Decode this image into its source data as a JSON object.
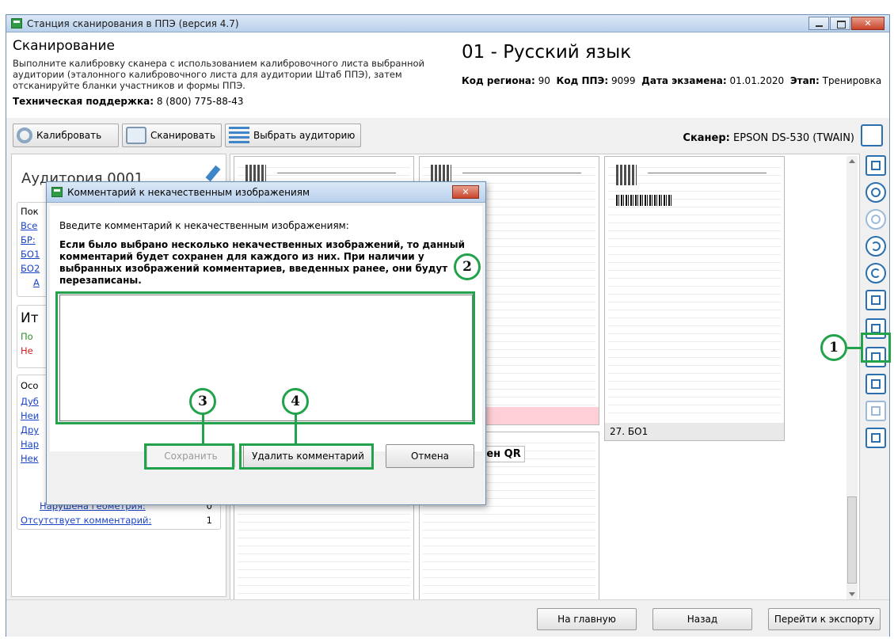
{
  "window": {
    "title": "Станция сканирования в ППЭ (версия 4.7)",
    "close_glyph": "✕"
  },
  "header": {
    "title": "Сканирование",
    "description": "Выполните калибровку сканера с использованием калибровочного листа выбранной аудитории (эталонного калибровочного листа для аудитории Штаб ППЭ), затем отсканируйте бланки участников и формы ППЭ.",
    "support_label": "Техническая поддержка:",
    "support_phone": "8 (800) 775-88-43",
    "subject": "01 - Русский язык",
    "region_label": "Код региона:",
    "region_value": "90",
    "ppe_label": "Код ППЭ:",
    "ppe_value": "9099",
    "date_label": "Дата экзамена:",
    "date_value": "01.01.2020",
    "stage_label": "Этап:",
    "stage_value": "Тренировка"
  },
  "toolbar": {
    "calibrate": "Калибровать",
    "scan": "Сканировать",
    "select_room": "Выбрать аудиторию",
    "scanner_label": "Сканер:",
    "scanner_value": "EPSON DS-530 (TWAIN)"
  },
  "left_panel": {
    "room_title": "Аудитория 0001",
    "frag_pok": "Пок",
    "frag_vse": "Все",
    "frag_br": "БР:",
    "frag_bo1": "БО1",
    "frag_bo2": "БО2",
    "frag_dot": "А",
    "frag_it": "Ит",
    "frag_po": "По",
    "frag_ne": "Не",
    "frag_oso": "Осо",
    "frag_dub": "Дуб",
    "frag_nei": "Неи",
    "frag_dru": "Дру",
    "frag_nar": "Нар",
    "frag_nek": "Нек",
    "geometry_label": "Нарушена геометрия:",
    "geometry_value": "0",
    "no_comment_label": "Отсутствует комментарий:",
    "no_comment_value": "1"
  },
  "images": {
    "thumb3_label": "27. БО1",
    "qr_tag": "елен QR"
  },
  "bottom": {
    "home": "На главную",
    "back": "Назад",
    "export": "Перейти к экспорту"
  },
  "dialog": {
    "title": "Комментарий к некачественным изображениям",
    "prompt": "Введите комментарий к некачественным изображениям:",
    "warning": "Если было выбрано несколько некачественных изображений, то данный комментарий будет сохранен для каждого из них. При наличии у выбранных изображений комментариев, введенных ранее, они будут перезаписаны.",
    "text_value": "",
    "save": "Сохранить",
    "delete": "Удалить комментарий",
    "cancel": "Отмена",
    "close_glyph": "✕"
  },
  "callouts": {
    "c1": "1",
    "c2": "2",
    "c3": "3",
    "c4": "4"
  },
  "colors": {
    "highlight": "#22a34b",
    "link": "#1a44c8",
    "accent": "#2b6fae"
  }
}
